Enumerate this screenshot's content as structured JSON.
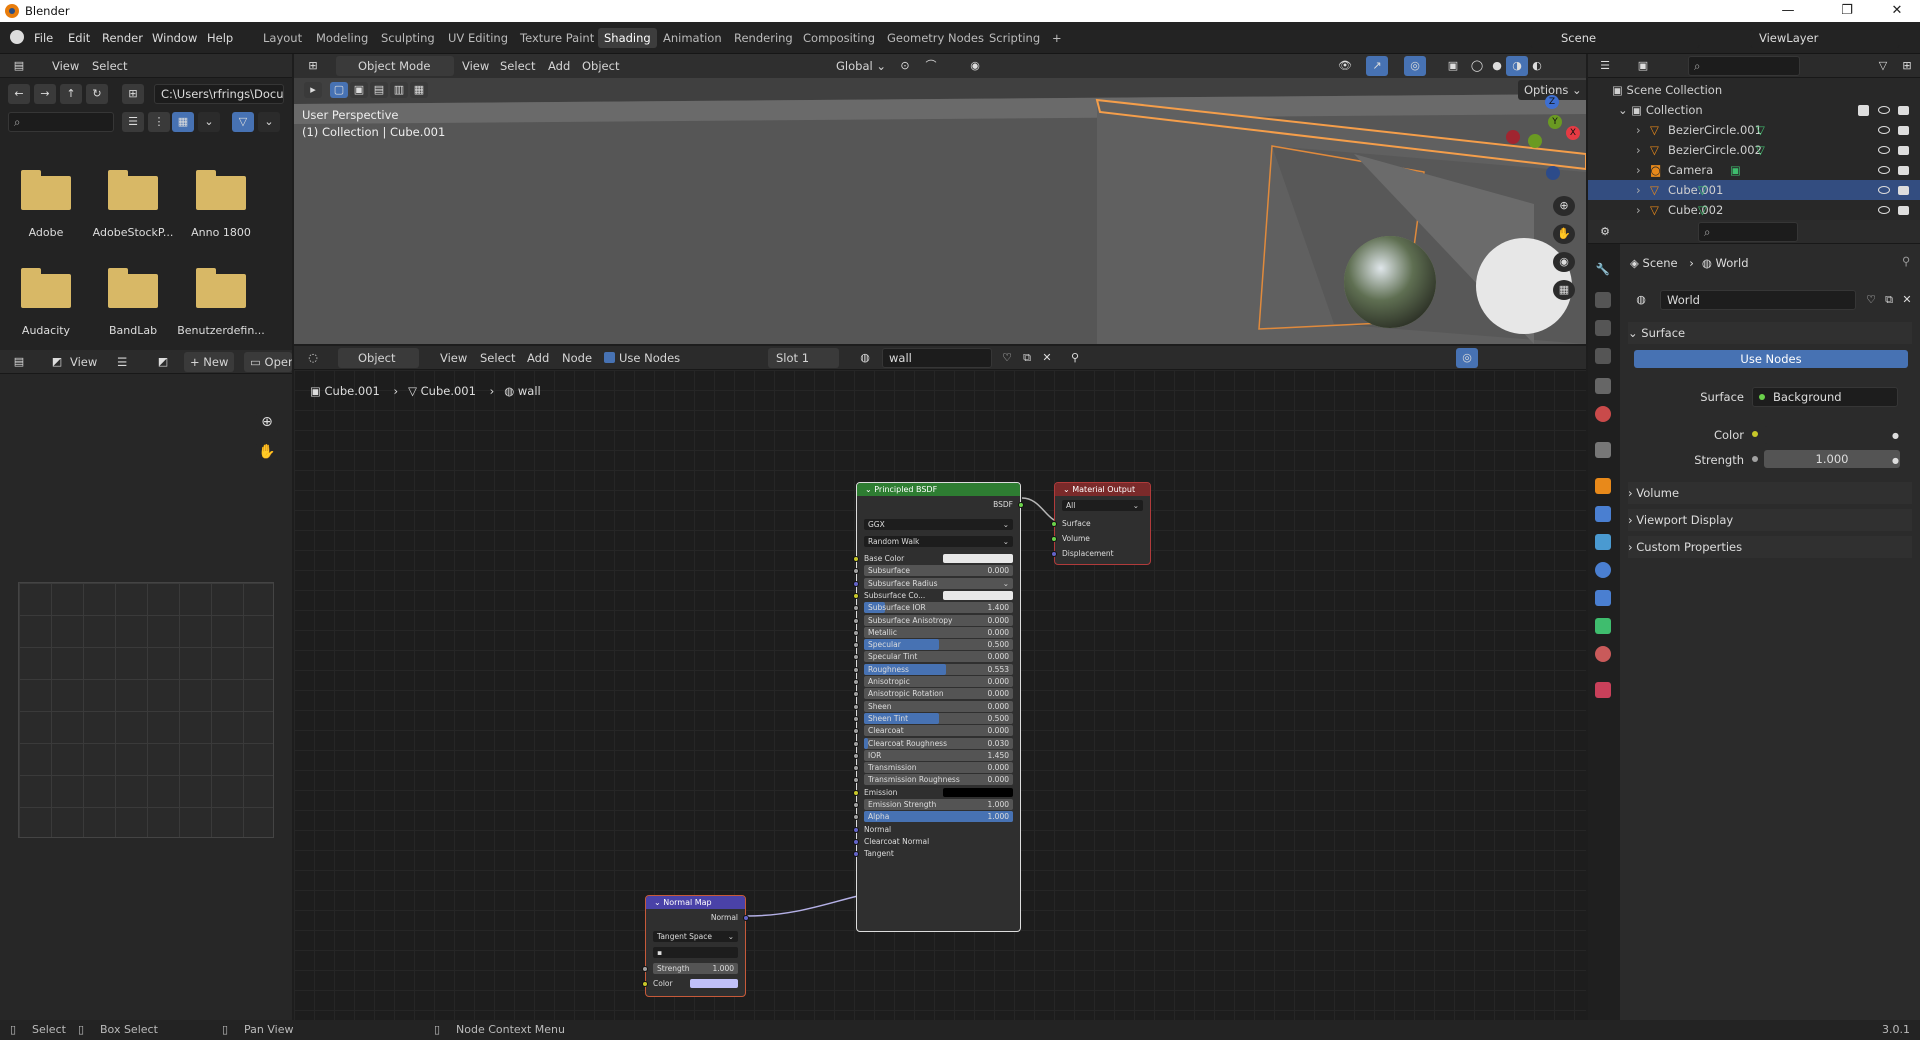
{
  "window": {
    "title": "Blender",
    "minimize": "—",
    "maximize": "❐",
    "close": "✕"
  },
  "menu": [
    "File",
    "Edit",
    "Render",
    "Window",
    "Help"
  ],
  "workspaces": [
    "Layout",
    "Modeling",
    "Sculpting",
    "UV Editing",
    "Texture Paint",
    "Shading",
    "Animation",
    "Rendering",
    "Compositing",
    "Geometry Nodes",
    "Scripting",
    "+"
  ],
  "active_workspace": "Shading",
  "scene": {
    "name": "Scene",
    "view_layer": "ViewLayer"
  },
  "file_browser": {
    "menus": [
      "View",
      "Select"
    ],
    "path": "C:\\Users\\rfrings\\Docu...",
    "folders": [
      "Adobe",
      "AdobeStockP...",
      "Anno 1800",
      "Audacity",
      "BandLab",
      "Benutzerdefin..."
    ]
  },
  "viewport": {
    "mode": "Object Mode",
    "menus": [
      "View",
      "Select",
      "Add",
      "Object"
    ],
    "orientation": "Global",
    "options": "Options",
    "info_line1": "User Perspective",
    "info_line2": "(1) Collection | Cube.001",
    "gizmo": {
      "z": "Z",
      "y": "Y",
      "x": "X"
    }
  },
  "image_editor": {
    "view": "View",
    "new": "New",
    "open": "Open"
  },
  "node_editor": {
    "type": "Object",
    "menus": [
      "View",
      "Select",
      "Add",
      "Node"
    ],
    "use_nodes": "Use Nodes",
    "slot": "Slot 1",
    "material": "wall",
    "breadcrumb": [
      "Cube.001",
      "Cube.001",
      "wall"
    ]
  },
  "principled": {
    "title": "Principled BSDF",
    "output": "BSDF",
    "distribution": "GGX",
    "subsurface_method": "Random Walk",
    "rows": [
      {
        "label": "Base Color",
        "type": "color",
        "color": "#e8e8e8"
      },
      {
        "label": "Subsurface",
        "value": "0.000",
        "fill": 0
      },
      {
        "label": "Subsurface Radius",
        "type": "dropdown"
      },
      {
        "label": "Subsurface Co...",
        "type": "color",
        "color": "#e8e8e8"
      },
      {
        "label": "Subsurface IOR",
        "value": "1.400",
        "fill": 0.14
      },
      {
        "label": "Subsurface Anisotropy",
        "value": "0.000",
        "fill": 0
      },
      {
        "label": "Metallic",
        "value": "0.000",
        "fill": 0
      },
      {
        "label": "Specular",
        "value": "0.500",
        "fill": 0.5
      },
      {
        "label": "Specular Tint",
        "value": "0.000",
        "fill": 0
      },
      {
        "label": "Roughness",
        "value": "0.553",
        "fill": 0.553
      },
      {
        "label": "Anisotropic",
        "value": "0.000",
        "fill": 0
      },
      {
        "label": "Anisotropic Rotation",
        "value": "0.000",
        "fill": 0
      },
      {
        "label": "Sheen",
        "value": "0.000",
        "fill": 0
      },
      {
        "label": "Sheen Tint",
        "value": "0.500",
        "fill": 0.5
      },
      {
        "label": "Clearcoat",
        "value": "0.000",
        "fill": 0
      },
      {
        "label": "Clearcoat Roughness",
        "value": "0.030",
        "fill": 0.03
      },
      {
        "label": "IOR",
        "value": "1.450",
        "fill": 0
      },
      {
        "label": "Transmission",
        "value": "0.000",
        "fill": 0
      },
      {
        "label": "Transmission Roughness",
        "value": "0.000",
        "fill": 0
      },
      {
        "label": "Emission",
        "type": "color",
        "color": "#000000"
      },
      {
        "label": "Emission Strength",
        "value": "1.000",
        "fill": 0
      },
      {
        "label": "Alpha",
        "value": "1.000",
        "fill": 1
      },
      {
        "label": "Normal",
        "type": "socket"
      },
      {
        "label": "Clearcoat Normal",
        "type": "socket"
      },
      {
        "label": "Tangent",
        "type": "socket"
      }
    ]
  },
  "material_output": {
    "title": "Material Output",
    "target": "All",
    "inputs": [
      "Surface",
      "Volume",
      "Displacement"
    ]
  },
  "normal_map": {
    "title": "Normal Map",
    "output": "Normal",
    "space": "Tangent Space",
    "strength_label": "Strength",
    "strength": "1.000",
    "color_label": "Color",
    "color": "#c0c0f8"
  },
  "outliner": {
    "root": "Scene Collection",
    "collection": "Collection",
    "items": [
      "BezierCircle.001",
      "BezierCircle.002",
      "Camera",
      "Cube.001",
      "Cube.002"
    ],
    "selected": "Cube.001"
  },
  "properties": {
    "breadcrumb": [
      "Scene",
      "World"
    ],
    "world": "World",
    "surface_panel": "Surface",
    "use_nodes": "Use Nodes",
    "surface_label": "Surface",
    "surface_value": "Background",
    "color_label": "Color",
    "strength_label": "Strength",
    "strength_value": "1.000",
    "panels": [
      "Volume",
      "Viewport Display",
      "Custom Properties"
    ]
  },
  "statusbar": {
    "select": "Select",
    "box_select": "Box Select",
    "pan_view": "Pan View",
    "context": "Node Context Menu",
    "version": "3.0.1"
  },
  "colors": {
    "accent": "#4772b3",
    "selected_row": "#334d80",
    "node_shader": "#2e7d32",
    "node_output": "#b13b3b",
    "node_vector": "#5a52b8",
    "folder": "#d8b866"
  }
}
